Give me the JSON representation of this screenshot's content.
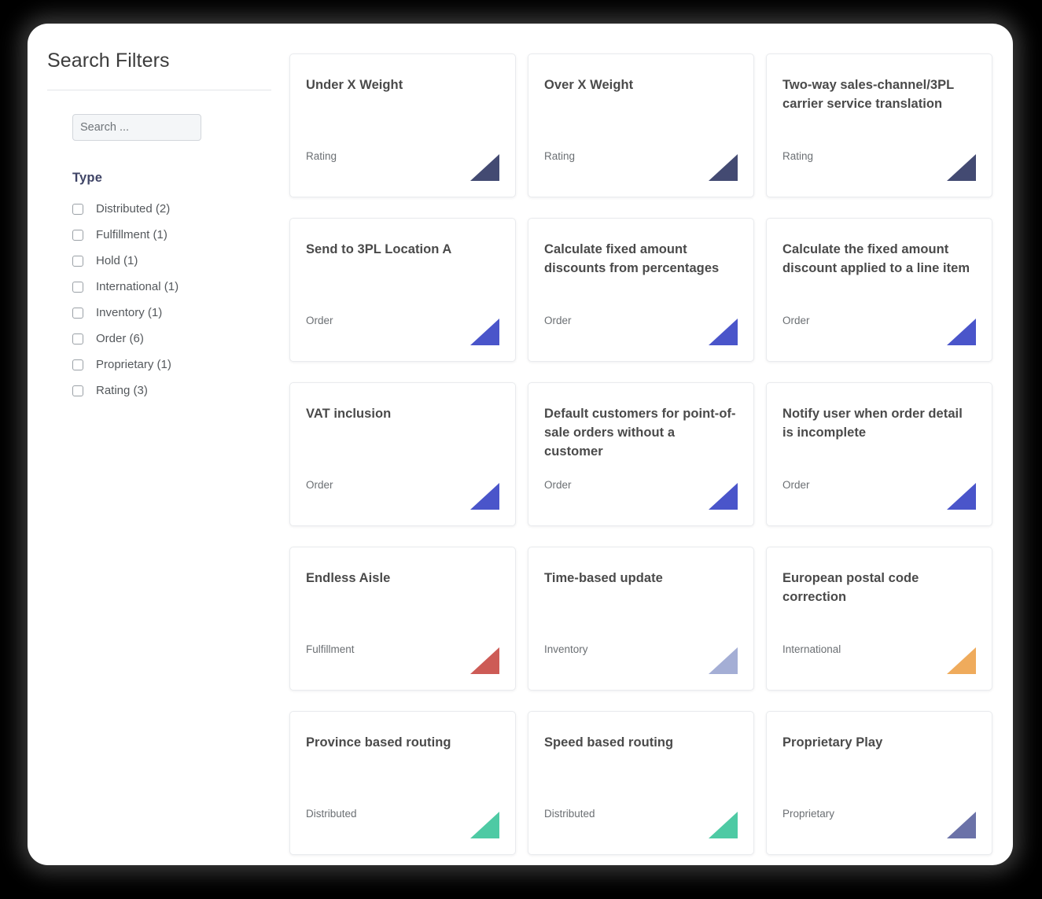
{
  "sidebar": {
    "title": "Search Filters",
    "search": {
      "placeholder": "Search ...",
      "value": ""
    },
    "facet": {
      "title": "Type",
      "options": [
        {
          "name": "Distributed",
          "count": 2,
          "label": "Distributed (2)",
          "checked": false
        },
        {
          "name": "Fulfillment",
          "count": 1,
          "label": "Fulfillment (1)",
          "checked": false
        },
        {
          "name": "Hold",
          "count": 1,
          "label": "Hold (1)",
          "checked": false
        },
        {
          "name": "International",
          "count": 1,
          "label": "International (1)",
          "checked": false
        },
        {
          "name": "Inventory",
          "count": 1,
          "label": "Inventory (1)",
          "checked": false
        },
        {
          "name": "Order",
          "count": 6,
          "label": "Order (6)",
          "checked": false
        },
        {
          "name": "Proprietary",
          "count": 1,
          "label": "Proprietary (1)",
          "checked": false
        },
        {
          "name": "Rating",
          "count": 3,
          "label": "Rating (3)",
          "checked": false
        }
      ]
    }
  },
  "type_colors": {
    "Rating": "#434a72",
    "Order": "#4a55ca",
    "Fulfillment": "#cd5b56",
    "Inventory": "#a4aed5",
    "International": "#efab5c",
    "Distributed": "#4ecaa4",
    "Proprietary": "#6b72a8"
  },
  "results": {
    "cards": [
      {
        "title": "Under X Weight",
        "type": "Rating"
      },
      {
        "title": "Over X Weight",
        "type": "Rating"
      },
      {
        "title": "Two-way sales-channel/3PL carrier service translation",
        "type": "Rating"
      },
      {
        "title": "Send to 3PL Location A",
        "type": "Order"
      },
      {
        "title": "Calculate fixed amount discounts from percentages",
        "type": "Order"
      },
      {
        "title": "Calculate the fixed amount discount applied to a line item",
        "type": "Order"
      },
      {
        "title": "VAT inclusion",
        "type": "Order"
      },
      {
        "title": "Default customers for point-of-sale orders without a customer",
        "type": "Order"
      },
      {
        "title": "Notify user when order detail is incomplete",
        "type": "Order"
      },
      {
        "title": "Endless Aisle",
        "type": "Fulfillment"
      },
      {
        "title": "Time-based update",
        "type": "Inventory"
      },
      {
        "title": "European postal code correction",
        "type": "International"
      },
      {
        "title": "Province based routing",
        "type": "Distributed"
      },
      {
        "title": "Speed based routing",
        "type": "Distributed"
      },
      {
        "title": "Proprietary Play",
        "type": "Proprietary"
      }
    ]
  }
}
